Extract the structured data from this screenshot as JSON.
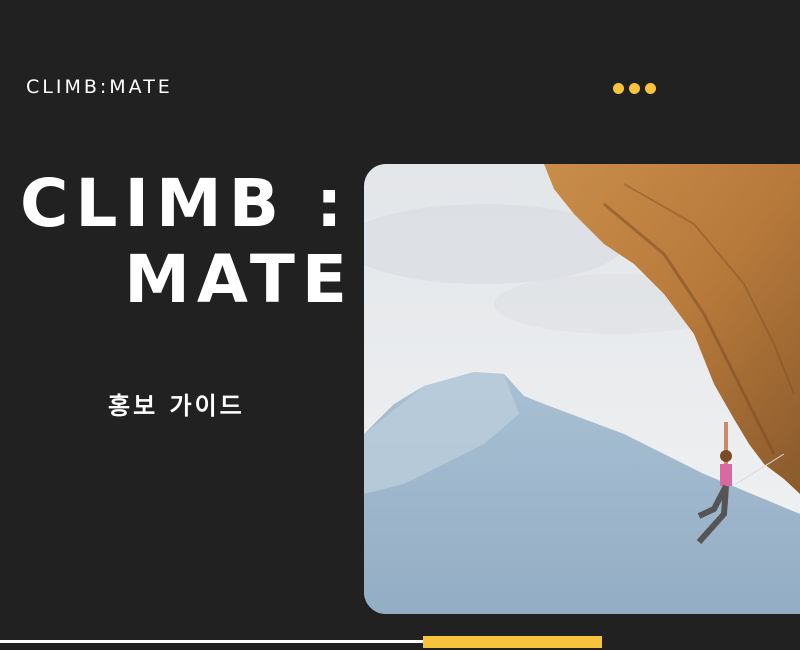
{
  "header": {
    "brand": "CLIMB:MATE"
  },
  "hero": {
    "title_line_1": "CLIMB :",
    "title_line_2": "MATE",
    "subtitle": "홍보 가이드"
  },
  "image": {
    "icon": "rock-climber-photo"
  },
  "colors": {
    "background": "#212121",
    "accent": "#f6c33d",
    "text": "#ffffff"
  }
}
